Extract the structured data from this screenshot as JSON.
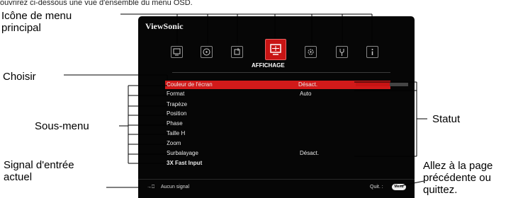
{
  "intro_line": "ouvrirez ci-dessous une vue d'ensemble du menu OSD.",
  "annotations": {
    "main_menu_icon": [
      "Icône de menu",
      "principal"
    ],
    "select": "Choisir",
    "submenu": "Sous-menu",
    "status": "Statut",
    "input_signal": [
      "Signal d'entrée",
      "actuel"
    ],
    "back_exit": [
      "Allez à la page",
      "précédente ou",
      "quittez."
    ]
  },
  "osd": {
    "brand": "ViewSonic",
    "icons": [
      "picture-icon",
      "color-icon",
      "power-icon",
      "display-icon",
      "settings-icon",
      "advanced-icon",
      "info-icon"
    ],
    "active_tab_label": "AFFICHAGE",
    "rows": [
      {
        "label": "Couleur de l'écran",
        "value": "Désact.",
        "selected": true
      },
      {
        "label": "Format",
        "value": "Auto"
      },
      {
        "label": "Trapèze",
        "value": ""
      },
      {
        "label": "Position",
        "value": ""
      },
      {
        "label": "Phase",
        "value": ""
      },
      {
        "label": "Taille H",
        "value": ""
      },
      {
        "label": "Zoom",
        "value": ""
      },
      {
        "label": "Surbalayage",
        "value": "Désact."
      },
      {
        "label": "3X Fast Input",
        "value": "",
        "bold": true
      }
    ],
    "footer": {
      "signal": "Aucun signal",
      "quit": "Quit. :",
      "menu_key": "Menu"
    }
  },
  "colors": {
    "accent": "#c81414",
    "osd_bg": "#060606"
  }
}
